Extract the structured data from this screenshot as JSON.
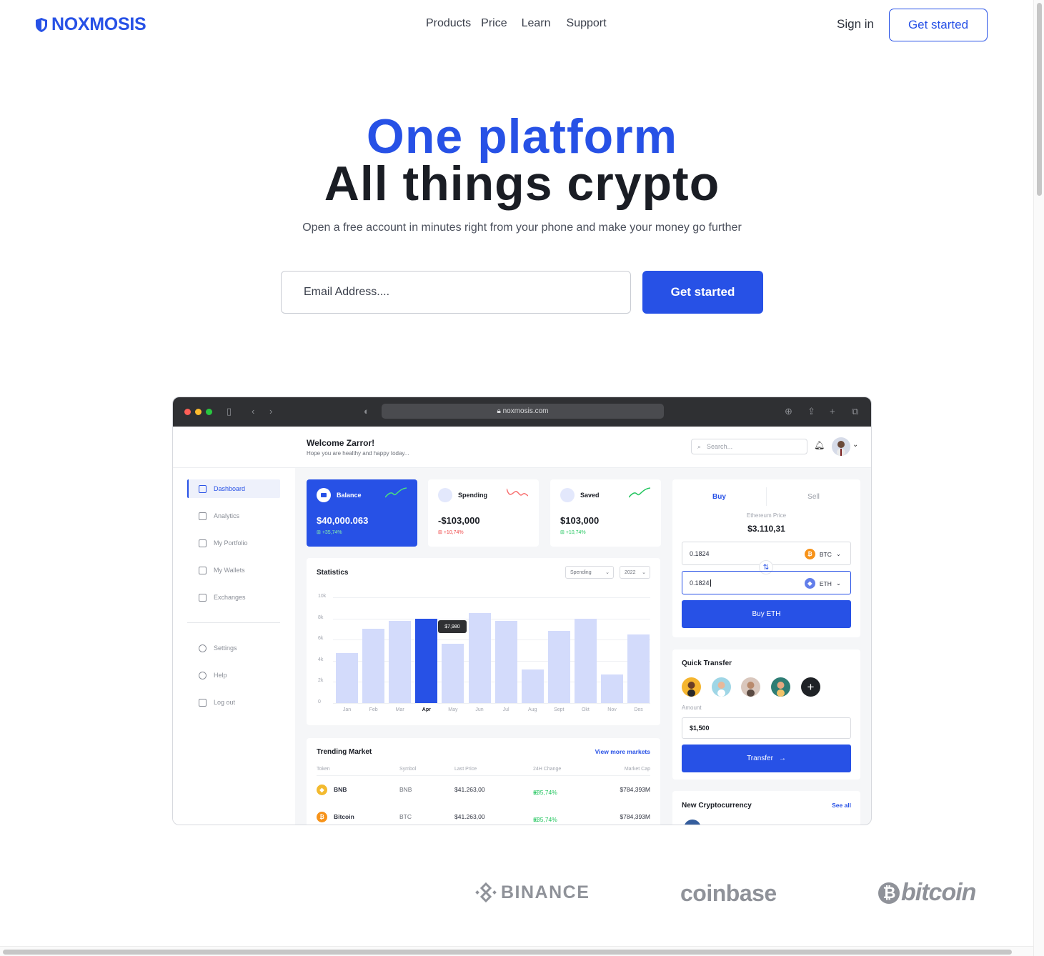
{
  "header": {
    "brand": "NOXMOSIS",
    "nav": [
      "Products",
      "Price",
      "Learn",
      "Support"
    ],
    "sign_in": "Sign in",
    "get_started": "Get started"
  },
  "hero": {
    "title_line1": "One platform",
    "title_line2": "All things crypto",
    "subtitle": "Open a free account in minutes right from your phone and make your money go further",
    "email_placeholder": "Email Address....",
    "cta": "Get started"
  },
  "dashboard": {
    "browser_url": "noxmosis.com",
    "welcome": "Welcome Zarror!",
    "welcome_sub": "Hope you are healthy and happy today...",
    "search_placeholder": "Search...",
    "sidebar": {
      "items": [
        "Dashboard",
        "Analytics",
        "My Portfolio",
        "My Wallets",
        "Exchanges"
      ],
      "bottom_items": [
        "Settings",
        "Help",
        "Log out"
      ],
      "active": "Dashboard"
    },
    "cards": [
      {
        "label": "Balance",
        "value": "$40,000.063",
        "change": "+35,74%",
        "trend": "up"
      },
      {
        "label": "Spending",
        "value": "-$103,000",
        "change": "+10,74%",
        "trend": "down"
      },
      {
        "label": "Saved",
        "value": "$103,000",
        "change": "+10,74%",
        "trend": "up"
      }
    ],
    "statistics": {
      "title": "Statistics",
      "filter_type": "Spending",
      "filter_year": "2022",
      "tooltip": "$7,980"
    },
    "trending": {
      "title": "Trending Market",
      "more": "View more markets",
      "columns": [
        "Token",
        "Symbol",
        "Last Price",
        "24H Change",
        "Market Cap"
      ],
      "rows": [
        {
          "token": "BNB",
          "symbol": "BNB",
          "price": "$41.263,00",
          "change": "+35,74%",
          "cap": "$784,393M",
          "color": "#f3ba2f"
        },
        {
          "token": "Bitcoin",
          "symbol": "BTC",
          "price": "$41.263,00",
          "change": "+35,74%",
          "cap": "$784,393M",
          "color": "#f7931a"
        }
      ]
    },
    "trade": {
      "tab_buy": "Buy",
      "tab_sell": "Sell",
      "price_label": "Ethereum Price",
      "price": "$3.110,31",
      "from_amount": "0.1824",
      "from_currency": "BTC",
      "to_amount": "0.1824",
      "to_currency": "ETH",
      "button": "Buy ETH"
    },
    "quick_transfer": {
      "title": "Quick Transfer",
      "amount_label": "Amount",
      "amount": "$1,500",
      "button": "Transfer"
    },
    "new_crypto": {
      "title": "New Cryptocurrency",
      "see_all": "See all"
    }
  },
  "chart_data": {
    "type": "bar",
    "categories": [
      "Jan",
      "Feb",
      "Mar",
      "Apr",
      "May",
      "Jun",
      "Jul",
      "Aug",
      "Sept",
      "Okt",
      "Nov",
      "Des"
    ],
    "values": [
      4700,
      7000,
      7800,
      7980,
      5600,
      8500,
      7800,
      3200,
      6800,
      8000,
      2700,
      6500
    ],
    "highlight": "Apr",
    "y_ticks": [
      "10k",
      "8k",
      "6k",
      "4k",
      "2k",
      "0"
    ],
    "ylim": [
      0,
      10000
    ],
    "accent": "#2751e6",
    "bar_color": "#d3dbfb"
  },
  "partners": [
    "BINANCE",
    "coinbase",
    "bitcoin"
  ],
  "colors": {
    "brand": "#2751e6",
    "text": "#1a1d24",
    "positive": "#22c55e",
    "negative": "#ef4444"
  }
}
